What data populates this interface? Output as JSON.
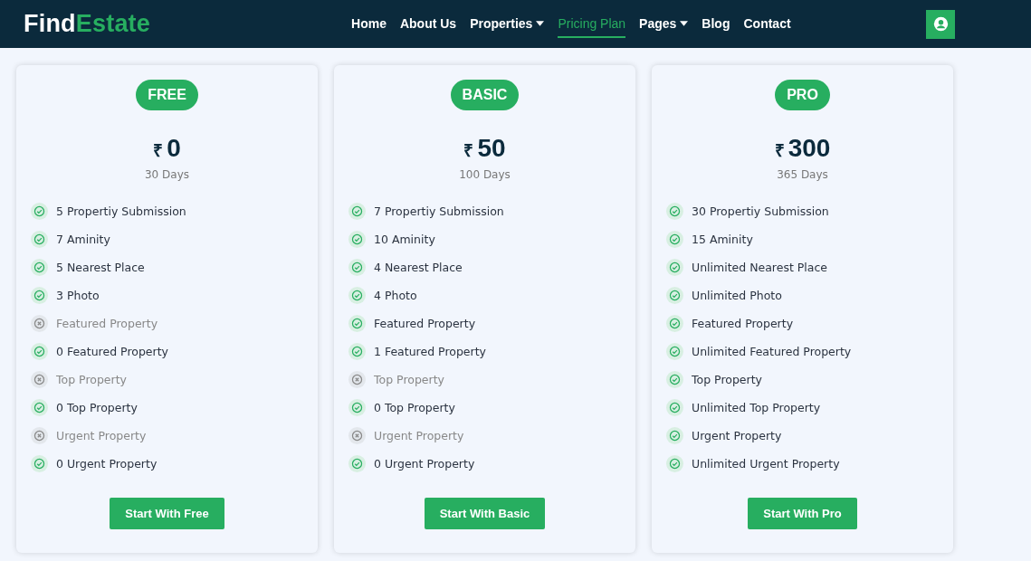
{
  "brand": {
    "part_1": "Find",
    "part_2": "Estate"
  },
  "nav": [
    {
      "label": "Home",
      "selected": false,
      "dropdown": false
    },
    {
      "label": "About Us",
      "selected": false,
      "dropdown": false
    },
    {
      "label": "Properties",
      "selected": false,
      "dropdown": true
    },
    {
      "label": "Pricing Plan",
      "selected": true,
      "dropdown": false
    },
    {
      "label": "Pages",
      "selected": false,
      "dropdown": true
    },
    {
      "label": "Blog",
      "selected": false,
      "dropdown": false
    },
    {
      "label": "Contact",
      "selected": false,
      "dropdown": false
    }
  ],
  "plans": [
    {
      "name": "FREE",
      "currency": "₹",
      "price": "0",
      "period": "30 Days",
      "button": "Start With Free",
      "features": [
        {
          "text": "5 Propertiy Submission",
          "included": true
        },
        {
          "text": "7 Aminity",
          "included": true
        },
        {
          "text": "5 Nearest Place",
          "included": true
        },
        {
          "text": "3 Photo",
          "included": true
        },
        {
          "text": "Featured Property",
          "included": false
        },
        {
          "text": "0 Featured Property",
          "included": true
        },
        {
          "text": "Top Property",
          "included": false
        },
        {
          "text": "0 Top Property",
          "included": true
        },
        {
          "text": "Urgent Property",
          "included": false
        },
        {
          "text": "0 Urgent Property",
          "included": true
        }
      ]
    },
    {
      "name": "BASIC",
      "currency": "₹",
      "price": "50",
      "period": "100 Days",
      "button": "Start With Basic",
      "features": [
        {
          "text": "7 Propertiy Submission",
          "included": true
        },
        {
          "text": "10 Aminity",
          "included": true
        },
        {
          "text": "4 Nearest Place",
          "included": true
        },
        {
          "text": "4 Photo",
          "included": true
        },
        {
          "text": "Featured Property",
          "included": true
        },
        {
          "text": "1 Featured Property",
          "included": true
        },
        {
          "text": "Top Property",
          "included": false
        },
        {
          "text": "0 Top Property",
          "included": true
        },
        {
          "text": "Urgent Property",
          "included": false
        },
        {
          "text": "0 Urgent Property",
          "included": true
        }
      ]
    },
    {
      "name": "PRO",
      "currency": "₹",
      "price": "300",
      "period": "365 Days",
      "button": "Start With Pro",
      "features": [
        {
          "text": "30 Propertiy Submission",
          "included": true
        },
        {
          "text": "15 Aminity",
          "included": true
        },
        {
          "text": "Unlimited Nearest Place",
          "included": true
        },
        {
          "text": "Unlimited Photo",
          "included": true
        },
        {
          "text": "Featured Property",
          "included": true
        },
        {
          "text": "Unlimited Featured Property",
          "included": true
        },
        {
          "text": "Top Property",
          "included": true
        },
        {
          "text": "Unlimited Top Property",
          "included": true
        },
        {
          "text": "Urgent Property",
          "included": true
        },
        {
          "text": "Unlimited Urgent Property",
          "included": true
        }
      ]
    }
  ]
}
